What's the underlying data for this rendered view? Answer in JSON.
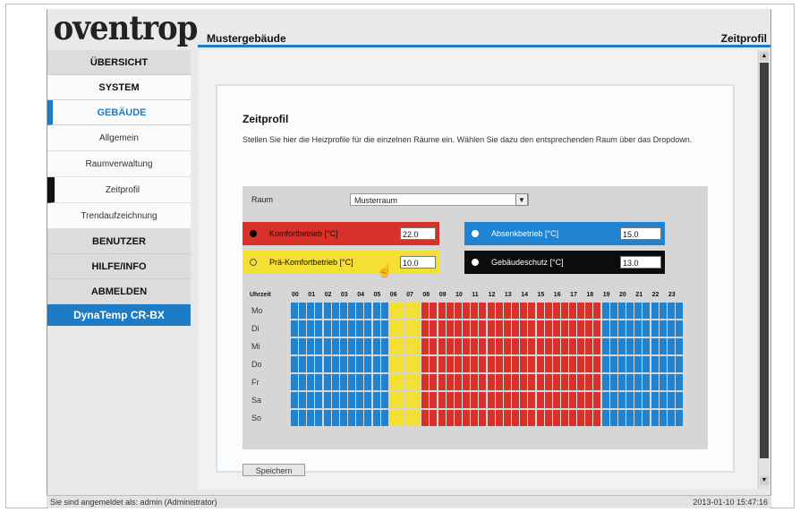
{
  "logo": "oventrop",
  "header": {
    "title": "Mustergebäude",
    "page": "Zeitprofil"
  },
  "nav": [
    {
      "label": "ÜBERSICHT",
      "style": "gray"
    },
    {
      "label": "SYSTEM",
      "style": "white"
    },
    {
      "label": "GEBÄUDE",
      "style": "active"
    }
  ],
  "subnav": [
    {
      "label": "Allgemein"
    },
    {
      "label": "Raumverwaltung"
    },
    {
      "label": "Zeitprofil",
      "selected": true
    },
    {
      "label": "Trendaufzeichnung"
    }
  ],
  "nav2": [
    {
      "label": "BENUTZER"
    },
    {
      "label": "HILFE/INFO"
    },
    {
      "label": "ABMELDEN"
    }
  ],
  "product": "DynaTemp CR-BX",
  "panel": {
    "title": "Zeitprofil",
    "description": "Stellen Sie hier die Heizprofile für die einzelnen Räume ein. Wählen Sie dazu den entsprechenden Raum über das Dropdown.",
    "room_label": "Raum",
    "room_value": "Musterraum",
    "save_label": "Speichern"
  },
  "profiles": [
    {
      "label": "Komfortbetrieb [°C]",
      "value": "22.0",
      "bg": "#d7312a",
      "dot": "#000000",
      "text": "#111111"
    },
    {
      "label": "Absenkbetrieb [°C]",
      "value": "15.0",
      "bg": "#1f83d2",
      "dot": "#ffffff",
      "text": "#ffffff"
    },
    {
      "label": "Prä-Komfortbetrieb [°C]",
      "value": "10.0",
      "bg": "#f4e032",
      "dot": "#f4e032",
      "text": "#111111"
    },
    {
      "label": "Gebäudeschutz [°C]",
      "value": "13.0",
      "bg": "#0c0c0c",
      "dot": "#ffffff",
      "text": "#ffffff"
    }
  ],
  "schedule": {
    "corner": "Uhrzeit",
    "hours": [
      "00",
      "01",
      "02",
      "03",
      "04",
      "05",
      "06",
      "07",
      "08",
      "09",
      "10",
      "11",
      "12",
      "13",
      "14",
      "15",
      "16",
      "17",
      "18",
      "19",
      "20",
      "21",
      "22",
      "23"
    ],
    "days": [
      "Mo",
      "Di",
      "Mi",
      "Do",
      "Fr",
      "Sa",
      "So"
    ],
    "pattern": "BBBBBBYYRRRRRRRRRRRBBBBB",
    "colors": {
      "B": "#1f83d2",
      "Y": "#f4e032",
      "R": "#d7312a"
    }
  },
  "status": {
    "left": "Sie sind angemeldet als: admin (Administrator)",
    "right": "2013-01-10 15:47:16"
  }
}
